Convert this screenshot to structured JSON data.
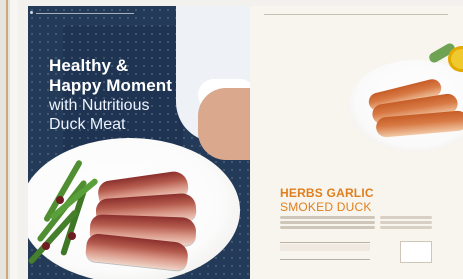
{
  "left_page": {
    "headline_bold": [
      "Healthy &",
      "Happy Moment"
    ],
    "headline_light": [
      "with Nutritious",
      "Duck Meat"
    ]
  },
  "right_page": {
    "dish_title_bold": "HERBS GARLIC",
    "dish_title_light": "SMOKED DUCK"
  },
  "colors": {
    "accent_orange": "#e07f1d",
    "left_bg_navy": "#233a58",
    "right_bg_cream": "#f8f5ef"
  }
}
